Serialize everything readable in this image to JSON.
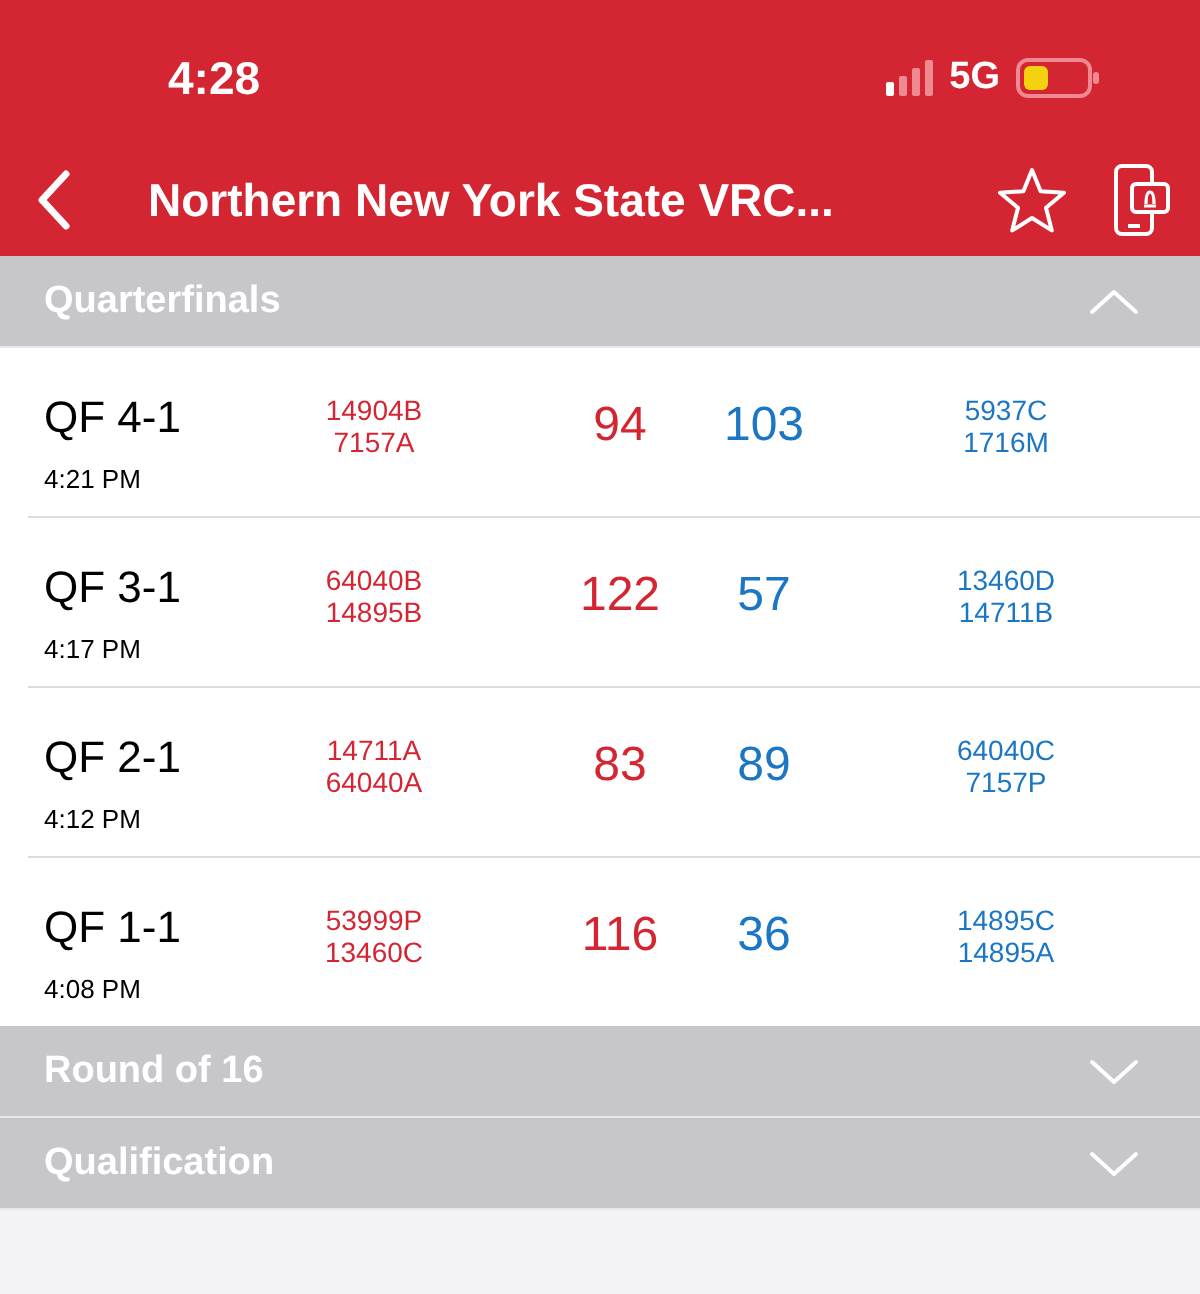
{
  "status_bar": {
    "time": "4:28",
    "network": "5G"
  },
  "nav": {
    "title": "Northern New York State VRC..."
  },
  "sections": [
    {
      "title": "Quarterfinals",
      "expanded": true,
      "matches": [
        {
          "name": "QF 4-1",
          "time": "4:21 PM",
          "red_teams": [
            "14904B",
            "7157A"
          ],
          "red_score": "94",
          "blue_score": "103",
          "blue_teams": [
            "5937C",
            "1716M"
          ]
        },
        {
          "name": "QF 3-1",
          "time": "4:17 PM",
          "red_teams": [
            "64040B",
            "14895B"
          ],
          "red_score": "122",
          "blue_score": "57",
          "blue_teams": [
            "13460D",
            "14711B"
          ]
        },
        {
          "name": "QF 2-1",
          "time": "4:12 PM",
          "red_teams": [
            "14711A",
            "64040A"
          ],
          "red_score": "83",
          "blue_score": "89",
          "blue_teams": [
            "64040C",
            "7157P"
          ]
        },
        {
          "name": "QF 1-1",
          "time": "4:08 PM",
          "red_teams": [
            "53999P",
            "13460C"
          ],
          "red_score": "116",
          "blue_score": "36",
          "blue_teams": [
            "14895C",
            "14895A"
          ]
        }
      ]
    },
    {
      "title": "Round of 16",
      "expanded": false
    },
    {
      "title": "Qualification",
      "expanded": false
    }
  ]
}
